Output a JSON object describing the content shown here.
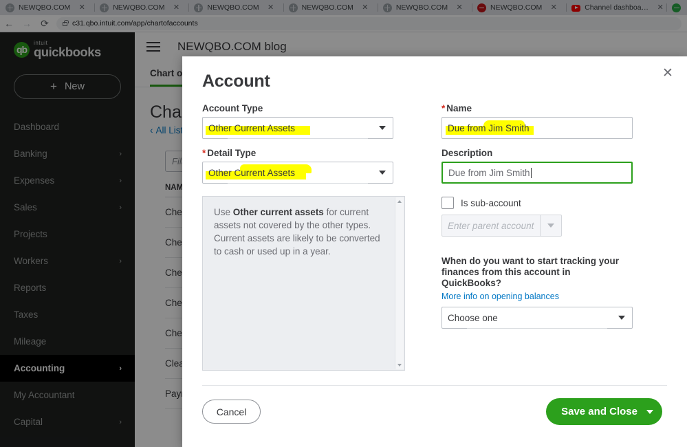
{
  "browser": {
    "tabs": [
      {
        "title": "NEWQBO.COM",
        "icon": "globe-icon",
        "favicon_style": "fav-globe"
      },
      {
        "title": "NEWQBO.COM",
        "icon": "globe-icon",
        "favicon_style": "fav-globe"
      },
      {
        "title": "NEWQBO.COM",
        "icon": "globe-icon",
        "favicon_style": "fav-globe"
      },
      {
        "title": "NEWQBO.COM",
        "icon": "globe-icon",
        "favicon_style": "fav-globe"
      },
      {
        "title": "NEWQBO.COM",
        "icon": "globe-icon",
        "favicon_style": "fav-globe"
      },
      {
        "title": "NEWQBO.COM",
        "icon": "red-shield-icon",
        "favicon_style": "fav-red"
      },
      {
        "title": "Channel dashboard - YouTu",
        "icon": "youtube-icon",
        "favicon_style": "fav-yt"
      }
    ],
    "close_glyph": "✕",
    "back_glyph": "←",
    "forward_glyph": "→",
    "reload_glyph": "⟳",
    "url": "c31.qbo.intuit.com/app/chartofaccounts"
  },
  "sidebar": {
    "logo": {
      "mark": "qb",
      "intuit": "intuit",
      "name": "quickbooks"
    },
    "new_button": {
      "plus": "+",
      "label": "New"
    },
    "items": [
      {
        "label": "Dashboard",
        "chevron": "",
        "active": false
      },
      {
        "label": "Banking",
        "chevron": "›",
        "active": false
      },
      {
        "label": "Expenses",
        "chevron": "›",
        "active": false
      },
      {
        "label": "Sales",
        "chevron": "›",
        "active": false
      },
      {
        "label": "Projects",
        "chevron": "",
        "active": false
      },
      {
        "label": "Workers",
        "chevron": "›",
        "active": false
      },
      {
        "label": "Reports",
        "chevron": "",
        "active": false
      },
      {
        "label": "Taxes",
        "chevron": "",
        "active": false
      },
      {
        "label": "Mileage",
        "chevron": "",
        "active": false
      },
      {
        "label": "Accounting",
        "chevron": "›",
        "active": true
      },
      {
        "label": "My Accountant",
        "chevron": "",
        "active": false
      },
      {
        "label": "Capital",
        "chevron": "›",
        "active": false
      }
    ]
  },
  "page": {
    "company_title": "NEWQBO.COM blog",
    "tab_label": "Chart of Accounts",
    "heading": "Chart of Accounts",
    "breadcrumb": {
      "caret": "‹",
      "label": "All Lists"
    },
    "filter_placeholder": "Filter by name or number",
    "table": {
      "headers": [
        "NAME"
      ],
      "rows": [
        {
          "name": "Checking"
        },
        {
          "name": "Checking"
        },
        {
          "name": "Checking"
        },
        {
          "name": "Checking"
        },
        {
          "name": "Checking"
        },
        {
          "name": "Clearing account"
        },
        {
          "name": "Payroll account"
        }
      ]
    },
    "edge_letter": "N"
  },
  "modal": {
    "title": "Account",
    "close_glyph": "✕",
    "account_type": {
      "label": "Account Type",
      "required": false,
      "value": "Other Current Assets",
      "highlighted": true
    },
    "detail_type": {
      "label": "Detail Type",
      "required": true,
      "required_glyph": "*",
      "value": "Other Current Assets",
      "highlighted": true
    },
    "help": {
      "prefix": "Use ",
      "bold": "Other current assets",
      "suffix": " for current assets not covered by the other types. Current assets are likely to be converted to cash or used up in a year."
    },
    "name": {
      "label": "Name",
      "required": true,
      "required_glyph": "*",
      "value": "Due from Jim Smith",
      "highlighted": true
    },
    "description": {
      "label": "Description",
      "required": false,
      "value": "Due from Jim Smith",
      "focused": true
    },
    "sub_account": {
      "label": "Is sub-account",
      "checked": false,
      "parent_placeholder": "Enter parent account",
      "parent_disabled": true
    },
    "opening_balance": {
      "question": "When do you want to start tracking your finances from this account in QuickBooks?",
      "link": "More info on opening balances",
      "select_value": "Choose one"
    },
    "cancel_label": "Cancel",
    "save_label": "Save and Close"
  },
  "colors": {
    "qb_green": "#2ca01c",
    "link_blue": "#0077c5",
    "highlight_yellow": "#ffff00",
    "required_red": "#d52b1e",
    "sidebar_bg": "#1f2120"
  }
}
